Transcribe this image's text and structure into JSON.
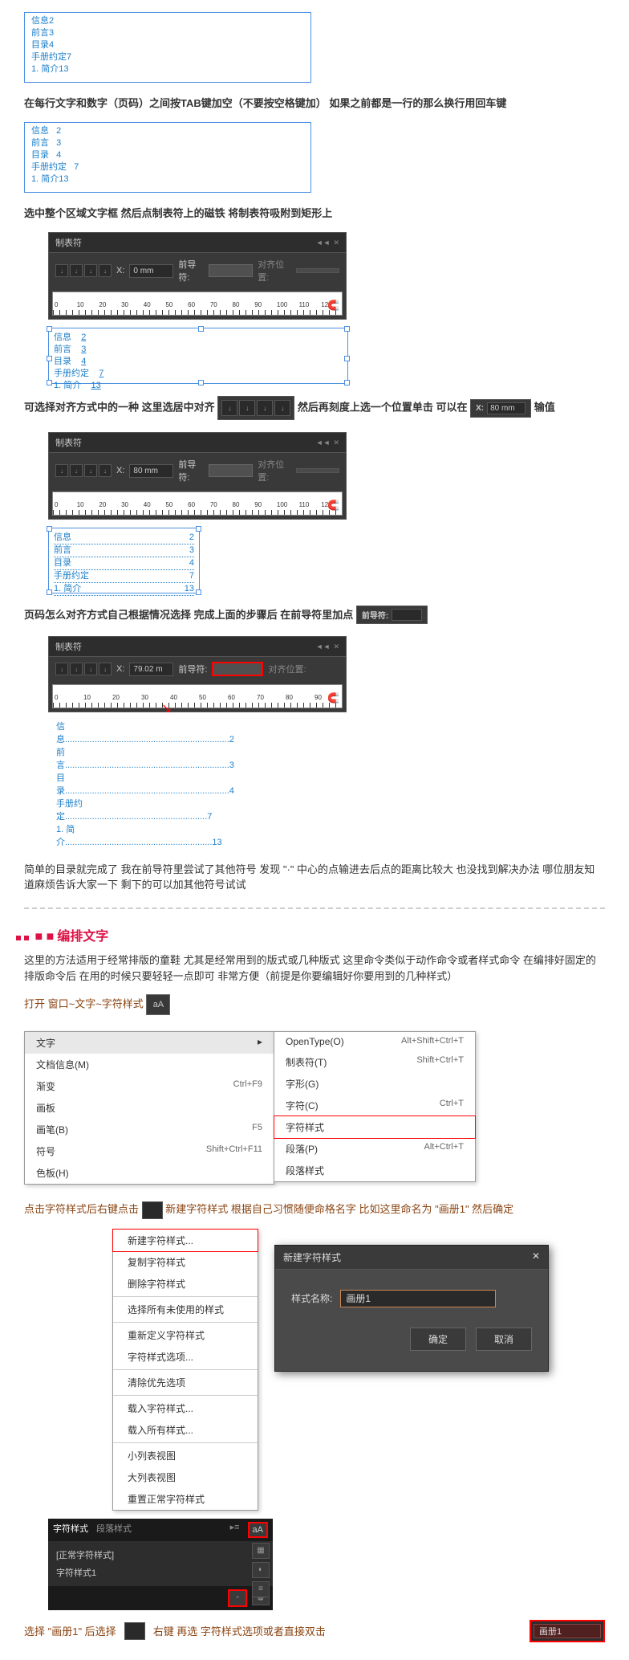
{
  "box1_lines": [
    "信息2",
    "前言3",
    "目录4",
    "手册约定7",
    "1. 简介13"
  ],
  "instruction1": "在每行文字和数字（页码）之间按TAB键加空（不要按空格键加） 如果之前都是一行的那么换行用回车键",
  "box2_lines": [
    "信息   2",
    "前言   3",
    "目录   4",
    "手册约定   7",
    "1. 简介13"
  ],
  "instruction2": "选中整个区域文字框 然后点制表符上的磁铁 将制表符吸附到矩形上",
  "tabpanel": {
    "title": "制表符",
    "x_label": "X:",
    "x_value": "0 mm",
    "leader_label": "前导符:",
    "align_label": "对齐位置:"
  },
  "ruler_numbers": [
    "0",
    "10",
    "20",
    "30",
    "40",
    "50",
    "60",
    "70",
    "80",
    "90",
    "100",
    "110",
    "120"
  ],
  "frame_lines": [
    {
      "t": "信息",
      "p": "2"
    },
    {
      "t": "前言",
      "p": "3"
    },
    {
      "t": "目录",
      "p": "4"
    },
    {
      "t": "手册约定",
      "p": "7"
    },
    {
      "t": "1. 简介",
      "p": "13"
    }
  ],
  "instruction3_a": "可选择对齐方式中的一种 这里选居中对齐",
  "instruction3_b": "然后再刻度上选一个位置单击 可以在",
  "instruction3_c": "输值",
  "x_value2": "80 mm",
  "tabpanel2_x": "80 mm",
  "instruction4": "页码怎么对齐方式自己根据情况选择  完成上面的步骤后 在前导符里加点",
  "leader_label_inline": "前导符:",
  "tabpanel3_x": "79.02 m",
  "toc_dotted": [
    {
      "t": "信息",
      "dots": "...................................................................",
      "p": "2"
    },
    {
      "t": "前言",
      "dots": "...................................................................",
      "p": "3"
    },
    {
      "t": "目录",
      "dots": "...................................................................",
      "p": "4"
    },
    {
      "t": "手册约定",
      "dots": "..........................................................",
      "p": "7"
    },
    {
      "t": "1. 简介",
      "dots": "............................................................",
      "p": "13"
    }
  ],
  "instruction5": "简单的目录就完成了 我在前导符里尝试了其他符号 发现 \"·\" 中心的点输进去后点的距离比较大 也没找到解决办法 哪位朋友知道麻烦告诉大家一下 剩下的可以加其他符号试试",
  "section_title": "编排文字",
  "section_desc": "这里的方法适用于经常排版的童鞋 尤其是经常用到的版式或几种版式 这里命令类似于动作命令或者样式命令 在编排好固定的排版命令后 在用的时候只要轻轻一点即可 非常方便（前提是你要编辑好你要用到的几种样式）",
  "open_menu": "打开  窗口~文字~字符样式",
  "menu1": {
    "header": "文字",
    "items": [
      {
        "l": "文档信息(M)",
        "s": ""
      },
      {
        "l": "渐变",
        "s": "Ctrl+F9"
      },
      {
        "l": "画板",
        "s": ""
      },
      {
        "l": "画笔(B)",
        "s": "F5"
      },
      {
        "l": "符号",
        "s": "Shift+Ctrl+F11"
      },
      {
        "l": "色板(H)",
        "s": ""
      }
    ]
  },
  "menu2": {
    "items": [
      {
        "l": "OpenType(O)",
        "s": "Alt+Shift+Ctrl+T"
      },
      {
        "l": "制表符(T)",
        "s": "Shift+Ctrl+T"
      },
      {
        "l": "字形(G)",
        "s": ""
      },
      {
        "l": "字符(C)",
        "s": "Ctrl+T"
      },
      {
        "l": "字符样式",
        "s": "",
        "hl": true
      },
      {
        "l": "段落(P)",
        "s": "Alt+Ctrl+T"
      },
      {
        "l": "段落样式",
        "s": ""
      }
    ]
  },
  "brown1_a": "点击字符样式后右键点击",
  "brown1_b": "新建字符样式 根据自己习惯随便命格名字 比如这里命名为 \"画册1\"  然后确定",
  "context_menu": [
    {
      "l": "新建字符样式...",
      "hl": true
    },
    {
      "l": "复制字符样式"
    },
    {
      "l": "删除字符样式"
    },
    {
      "div": true
    },
    {
      "l": "选择所有未使用的样式"
    },
    {
      "div": true
    },
    {
      "l": "重新定义字符样式"
    },
    {
      "l": "字符样式选项..."
    },
    {
      "div": true
    },
    {
      "l": "清除优先选项"
    },
    {
      "div": true
    },
    {
      "l": "载入字符样式..."
    },
    {
      "l": "载入所有样式..."
    },
    {
      "div": true
    },
    {
      "l": "小列表视图"
    },
    {
      "l": "大列表视图"
    },
    {
      "l": "重置正常字符样式"
    }
  ],
  "dialog": {
    "title": "新建字符样式",
    "label": "样式名称:",
    "value": "画册1",
    "ok": "确定",
    "cancel": "取消"
  },
  "char_panel": {
    "tab1": "字符样式",
    "tab2": "段落样式",
    "item1": "[正常字符样式]",
    "item2": "字符样式1"
  },
  "brown2": "选择 \"画册1\" 后选择",
  "brown2b": "右键  再选 字符样式选项或者直接双击",
  "strip_value": "画册1"
}
